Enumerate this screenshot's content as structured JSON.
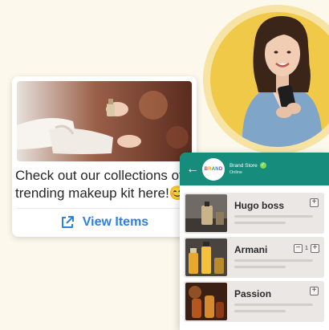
{
  "message_card": {
    "text": "Check out our collections of trending makeup kit here!😊",
    "button_label": "View Items"
  },
  "store": {
    "logo_text": "BRAND",
    "name": "Brand Store",
    "status": "Online",
    "verified_mark": "✓",
    "back_symbol": "←",
    "items": [
      {
        "name": "Hugo boss",
        "add_symbol": "+"
      },
      {
        "name": "Armani",
        "minus_symbol": "−",
        "quantity": "1",
        "plus_symbol": "+"
      },
      {
        "name": "Passion",
        "add_symbol": "+"
      }
    ]
  },
  "colors": {
    "background": "#fdf8ec",
    "hero_circle": "#f1c948",
    "header": "#168c7c",
    "accent_link": "#2d7fe0",
    "item_bg": "#ebe7e5"
  },
  "icons": [
    "external-link-icon",
    "back-arrow-icon",
    "verified-icon",
    "plus-icon",
    "minus-icon"
  ]
}
